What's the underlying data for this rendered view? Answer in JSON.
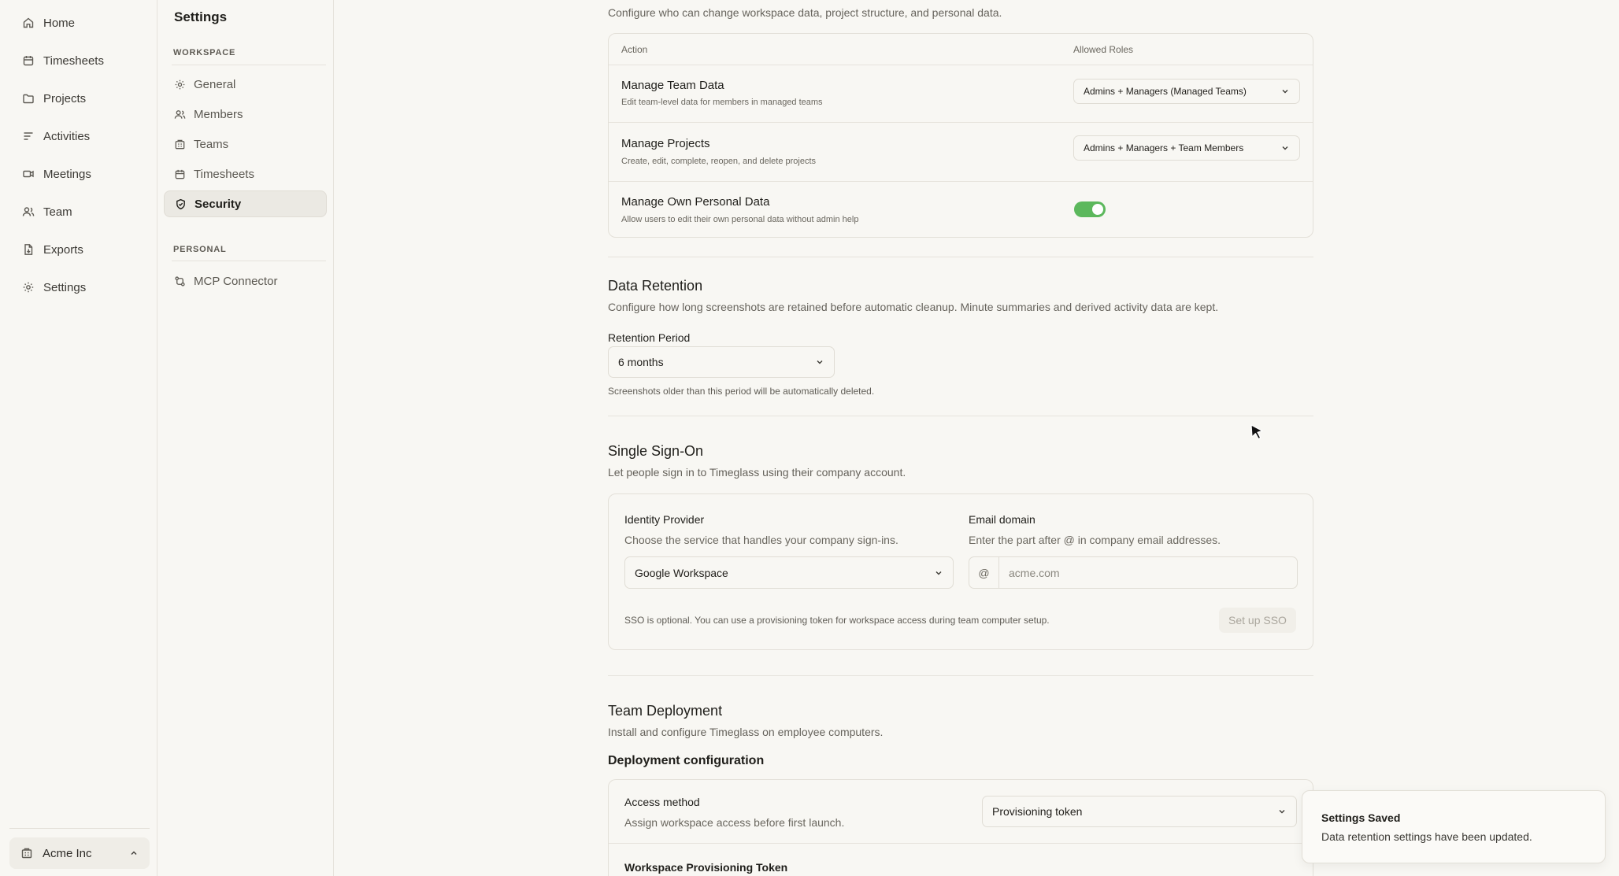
{
  "nav": {
    "items": [
      {
        "label": "Home",
        "icon": "home-icon"
      },
      {
        "label": "Timesheets",
        "icon": "calendar-icon"
      },
      {
        "label": "Projects",
        "icon": "folder-icon"
      },
      {
        "label": "Activities",
        "icon": "list-icon"
      },
      {
        "label": "Meetings",
        "icon": "video-icon"
      },
      {
        "label": "Team",
        "icon": "users-icon"
      },
      {
        "label": "Exports",
        "icon": "file-export-icon"
      },
      {
        "label": "Settings",
        "icon": "gear-icon"
      }
    ],
    "org": "Acme Inc"
  },
  "settings_nav": {
    "title": "Settings",
    "workspace_label": "WORKSPACE",
    "workspace_items": [
      {
        "label": "General",
        "icon": "gear-icon"
      },
      {
        "label": "Members",
        "icon": "users-icon"
      },
      {
        "label": "Teams",
        "icon": "building-icon"
      },
      {
        "label": "Timesheets",
        "icon": "calendar-icon"
      },
      {
        "label": "Security",
        "icon": "shield-icon",
        "active": true
      }
    ],
    "personal_label": "PERSONAL",
    "personal_items": [
      {
        "label": "MCP Connector",
        "icon": "connector-icon"
      }
    ]
  },
  "permissions": {
    "description": "Configure who can change workspace data, project structure, and personal data.",
    "header_action": "Action",
    "header_roles": "Allowed Roles",
    "rows": [
      {
        "name": "Manage Team Data",
        "desc": "Edit team-level data for members in managed teams",
        "value": "Admins + Managers (Managed Teams)"
      },
      {
        "name": "Manage Projects",
        "desc": "Create, edit, complete, reopen, and delete projects",
        "value": "Admins + Managers + Team Members"
      },
      {
        "name": "Manage Own Personal Data",
        "desc": "Allow users to edit their own personal data without admin help",
        "toggle_on": true
      }
    ]
  },
  "retention": {
    "title": "Data Retention",
    "description": "Configure how long screenshots are retained before automatic cleanup. Minute summaries and derived activity data are kept.",
    "period_label": "Retention Period",
    "period_value": "6 months",
    "note": "Screenshots older than this period will be automatically deleted."
  },
  "sso": {
    "title": "Single Sign-On",
    "description": "Let people sign in to Timeglass using their company account.",
    "provider_label": "Identity Provider",
    "provider_help": "Choose the service that handles your company sign-ins.",
    "provider_value": "Google Workspace",
    "domain_label": "Email domain",
    "domain_help": "Enter the part after @ in company email addresses.",
    "domain_prefix": "@",
    "domain_placeholder": "acme.com",
    "note": "SSO is optional. You can use a provisioning token for workspace access during team computer setup.",
    "setup_button": "Set up SSO"
  },
  "deployment": {
    "title": "Team Deployment",
    "description": "Install and configure Timeglass on employee computers.",
    "config_title": "Deployment configuration",
    "access_label": "Access method",
    "access_help": "Assign workspace access before first launch.",
    "access_value": "Provisioning token",
    "token_label": "Workspace Provisioning Token"
  },
  "toast": {
    "title": "Settings Saved",
    "message": "Data retention settings have been updated."
  },
  "colors": {
    "background": "#f8f7f3",
    "toggle_on": "#5cb85c",
    "border": "#e3e0d8"
  }
}
